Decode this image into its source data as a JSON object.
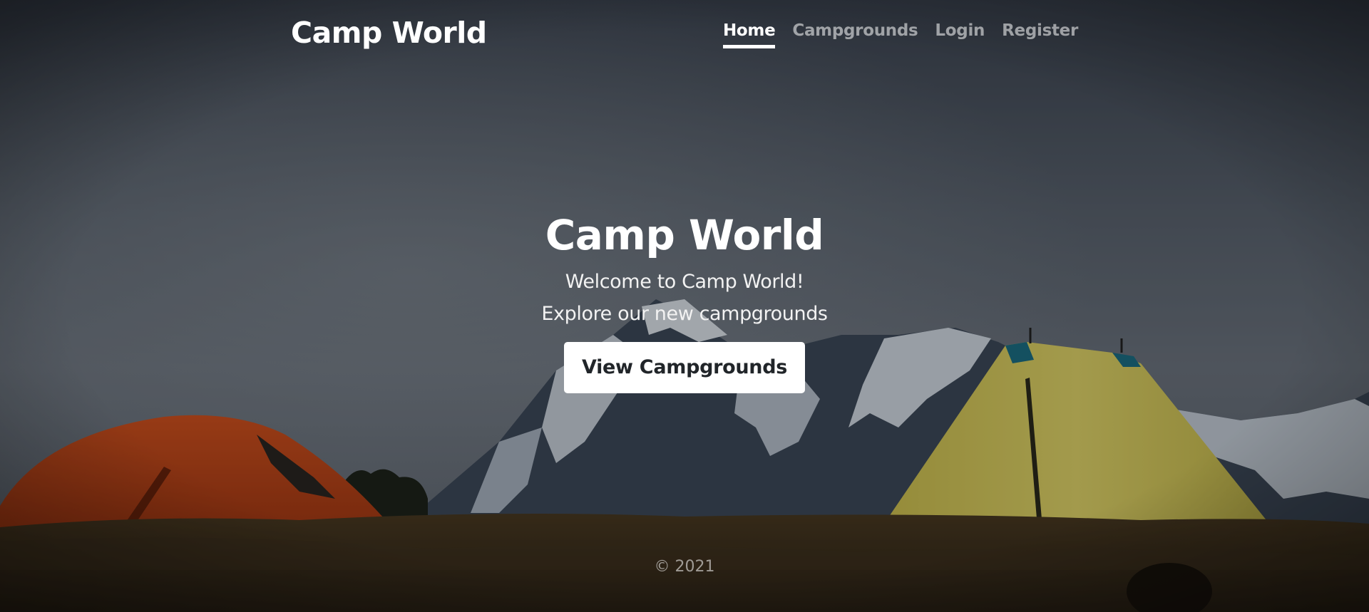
{
  "header": {
    "brand": "Camp World",
    "nav": [
      {
        "label": "Home",
        "active": true
      },
      {
        "label": "Campgrounds",
        "active": false
      },
      {
        "label": "Login",
        "active": false
      },
      {
        "label": "Register",
        "active": false
      }
    ]
  },
  "hero": {
    "title": "Camp World",
    "line1": "Welcome to Camp World!",
    "line2": "Explore our new campgrounds",
    "cta_label": "View Campgrounds"
  },
  "footer": {
    "copyright": "© 2021"
  },
  "colors": {
    "sky": "#4a5360",
    "ground": "#3b2f1e",
    "orange_tent": "#c0461c",
    "yellow_tent": "#d6cb5c",
    "button_bg": "#ffffff",
    "button_text": "#212529"
  }
}
